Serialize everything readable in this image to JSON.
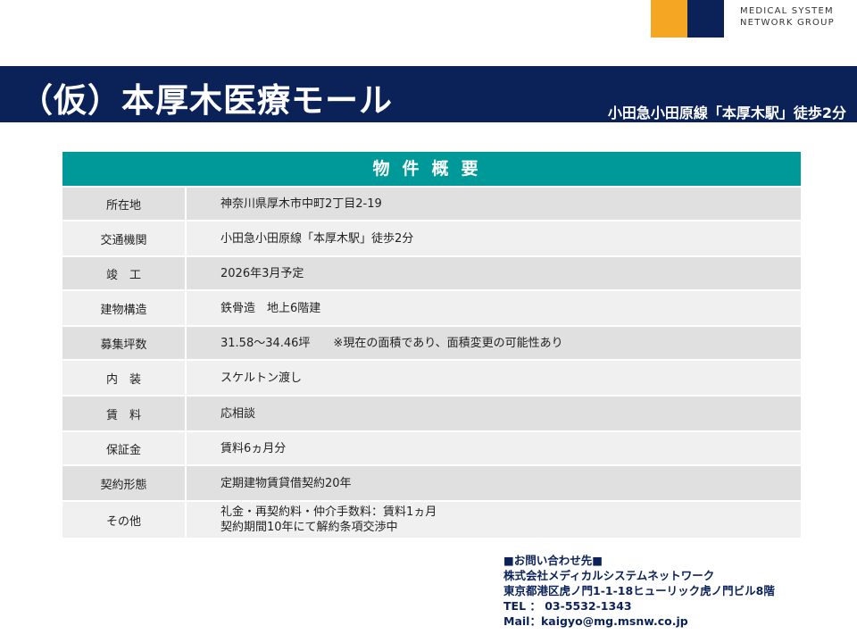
{
  "colors": {
    "navy": "#0b2259",
    "orange": "#f5a623",
    "teal": "#00999a",
    "row_dark": "#e0e0e0",
    "row_light": "#f0f0f0",
    "contact_text": "#0b2259"
  },
  "logo": {
    "line1": "MEDICAL SYSTEM",
    "line2": "NETWORK GROUP"
  },
  "header": {
    "title": "（仮）本厚木医療モール",
    "access": "小田急小田原線「本厚木駅」徒歩2分"
  },
  "table": {
    "heading": "物件概要",
    "rows": [
      {
        "label": "所在地",
        "value": [
          "神奈川県厚木市中町2丁目2-19"
        ]
      },
      {
        "label": "交通機関",
        "value": [
          "小田急小田原線「本厚木駅」徒歩2分"
        ]
      },
      {
        "label": "竣　工",
        "value": [
          "2026年3月予定"
        ]
      },
      {
        "label": "建物構造",
        "value": [
          "鉄骨造　地上6階建"
        ]
      },
      {
        "label": "募集坪数",
        "value": [
          "31.58～34.46坪　　※現在の面積であり、面積変更の可能性あり"
        ]
      },
      {
        "label": "内　装",
        "value": [
          "スケルトン渡し"
        ]
      },
      {
        "label": "賃　料",
        "value": [
          "応相談"
        ]
      },
      {
        "label": "保証金",
        "value": [
          "賃料6ヵ月分"
        ]
      },
      {
        "label": "契約形態",
        "value": [
          "定期建物賃貸借契約20年"
        ]
      },
      {
        "label": "その他",
        "value": [
          "礼金・再契約料・仲介手数料：賃料1ヵ月",
          "契約期間10年にて解約条項交渉中"
        ]
      }
    ]
  },
  "contact": {
    "heading": "■お問い合わせ先■",
    "company": "株式会社メディカルシステムネットワーク",
    "address": "東京都港区虎ノ門1-1-18ヒューリック虎ノ門ビル8階",
    "tel": "TEL ： 03-5532-1343",
    "mail": "Mail：kaigyo@mg.msnw.co.jp"
  }
}
